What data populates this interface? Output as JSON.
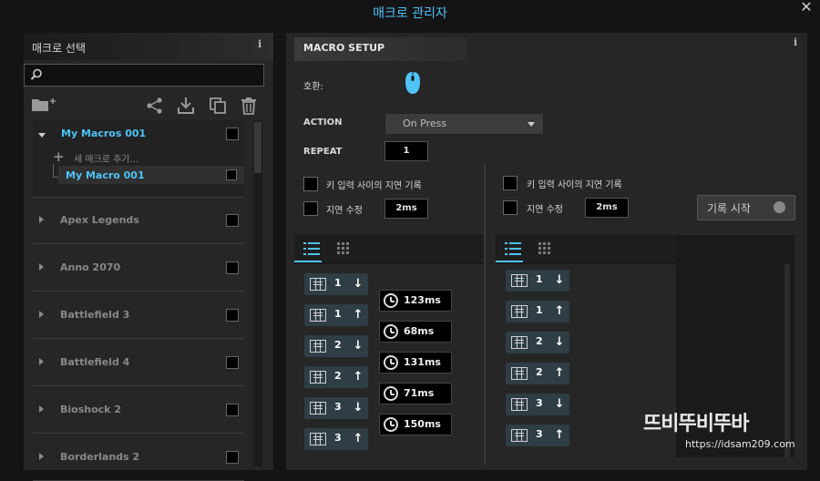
{
  "window": {
    "title": "매크로 관리자",
    "close": "✕"
  },
  "left_panel": {
    "title": "매크로 선택",
    "info": "i",
    "search_placeholder": "",
    "tree": {
      "expanded_group": "My Macros 001",
      "add_new": "새 매크로 추가...",
      "selected_macro": "My Macro 001"
    },
    "games": [
      "Apex Legends",
      "Anno 2070",
      "Battlefield 3",
      "Battlefield 4",
      "Bioshock 2",
      "Borderlands 2"
    ]
  },
  "right_panel": {
    "title": "MACRO SETUP",
    "info": "i",
    "compat_label": "호환:",
    "action_label": "ACTION",
    "action_value": "On Press",
    "repeat_label": "REPEAT",
    "repeat_value": "1",
    "left_settings": {
      "record_delay": "키 입력 사이의 지연 기록",
      "edit_delay": "지연 수정",
      "delay_value": "2ms"
    },
    "right_settings": {
      "record_delay": "키 입력 사이의 지연 기록",
      "edit_delay": "지연 수정",
      "delay_value": "2ms"
    },
    "record_button": "기록 시작",
    "left_list": [
      {
        "key": "1",
        "dir": "down",
        "delay": "123ms"
      },
      {
        "key": "1",
        "dir": "up",
        "delay": "68ms"
      },
      {
        "key": "2",
        "dir": "down",
        "delay": "131ms"
      },
      {
        "key": "2",
        "dir": "up",
        "delay": "71ms"
      },
      {
        "key": "3",
        "dir": "down",
        "delay": "150ms"
      },
      {
        "key": "3",
        "dir": "up",
        "delay": ""
      }
    ],
    "right_list": [
      {
        "key": "1",
        "dir": "down"
      },
      {
        "key": "1",
        "dir": "up"
      },
      {
        "key": "2",
        "dir": "down"
      },
      {
        "key": "2",
        "dir": "up"
      },
      {
        "key": "3",
        "dir": "down"
      },
      {
        "key": "3",
        "dir": "up"
      }
    ]
  },
  "watermark": {
    "text": "뜨비뚜비뚜바",
    "url": "https://idsam209.com"
  },
  "colors": {
    "accent": "#4fc3f7"
  }
}
